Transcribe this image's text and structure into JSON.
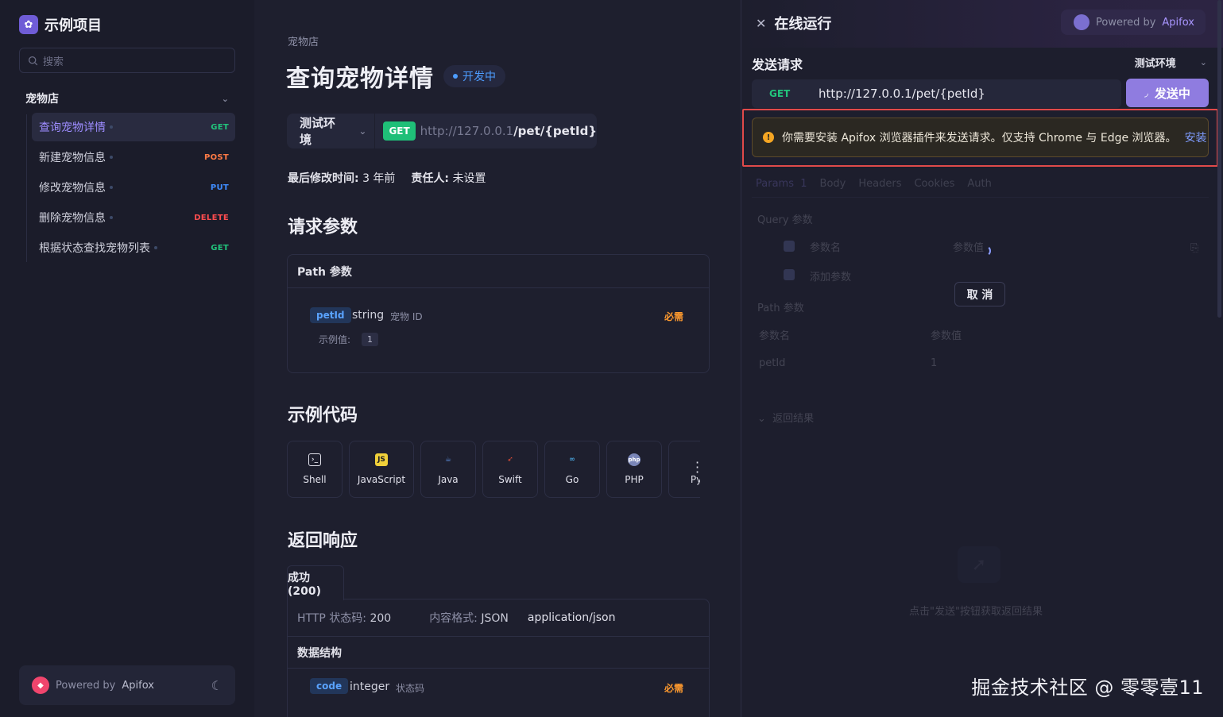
{
  "sidebar": {
    "project_name": "示例项目",
    "search_placeholder": "搜索",
    "group_title": "宠物店",
    "items": [
      {
        "label": "查询宠物详情",
        "method": "GET"
      },
      {
        "label": "新建宠物信息",
        "method": "POST"
      },
      {
        "label": "修改宠物信息",
        "method": "PUT"
      },
      {
        "label": "删除宠物信息",
        "method": "DELETE"
      },
      {
        "label": "根据状态查找宠物列表",
        "method": "GET"
      }
    ],
    "powered_prefix": "Powered by",
    "powered_brand": "Apifox"
  },
  "main": {
    "breadcrumb": "宠物店",
    "title": "查询宠物详情",
    "status_badge": "开发中",
    "env": "测试环境",
    "method": "GET",
    "url_host": "http://127.0.0.1",
    "url_path": "/pet/{petId}",
    "modified_label": "最后修改时间:",
    "modified_value": "3 年前",
    "owner_label": "责任人:",
    "owner_value": "未设置",
    "params_heading": "请求参数",
    "path_params_title": "Path 参数",
    "param": {
      "name": "petId",
      "type": "string",
      "desc": "宠物 ID",
      "required": "必需",
      "example_label": "示例值:",
      "example_value": "1"
    },
    "code_heading": "示例代码",
    "languages": [
      "Shell",
      "JavaScript",
      "Java",
      "Swift",
      "Go",
      "PHP",
      "Py"
    ],
    "response_heading": "返回响应",
    "response_tab": "成功(200)",
    "http_status_label": "HTTP 状态码:",
    "http_status_value": "200",
    "content_format_label": "内容格式:",
    "content_format_value": "JSON",
    "content_type": "application/json",
    "data_structure_label": "数据结构",
    "resp_field": {
      "name": "code",
      "type": "integer",
      "desc": "状态码",
      "required": "必需"
    }
  },
  "panel": {
    "title": "在线运行",
    "powered_prefix": "Powered by",
    "powered_brand": "Apifox",
    "send_title": "发送请求",
    "env": "测试环境",
    "method": "GET",
    "url": "http://127.0.0.1/pet/{petId}",
    "send_button": "发送中",
    "warning_text": "你需要安装 Apifox 浏览器插件来发送请求。仅支持 Chrome 与 Edge 浏览器。",
    "warning_link": "安装",
    "tabs": [
      "Params",
      "Body",
      "Headers",
      "Cookies",
      "Auth"
    ],
    "params_count": "1",
    "query_title": "Query 参数",
    "param_name_col": "参数名",
    "param_value_col": "参数值",
    "add_param": "添加参数",
    "cancel_button": "取 消",
    "path_title": "Path 参数",
    "path_param_name": "petId",
    "path_param_value": "1",
    "result_title": "返回结果",
    "empty_hint": "点击\"发送\"按钮获取返回结果"
  },
  "watermark": "掘金技术社区 @ 零零壹11",
  "colors": {
    "accent": "#9d8cff",
    "get": "#22c47c",
    "post": "#ff7a45",
    "put": "#3f8cff",
    "delete": "#ff4d4f",
    "required": "#ff9a2e",
    "warning_outline": "#e04a4a"
  }
}
